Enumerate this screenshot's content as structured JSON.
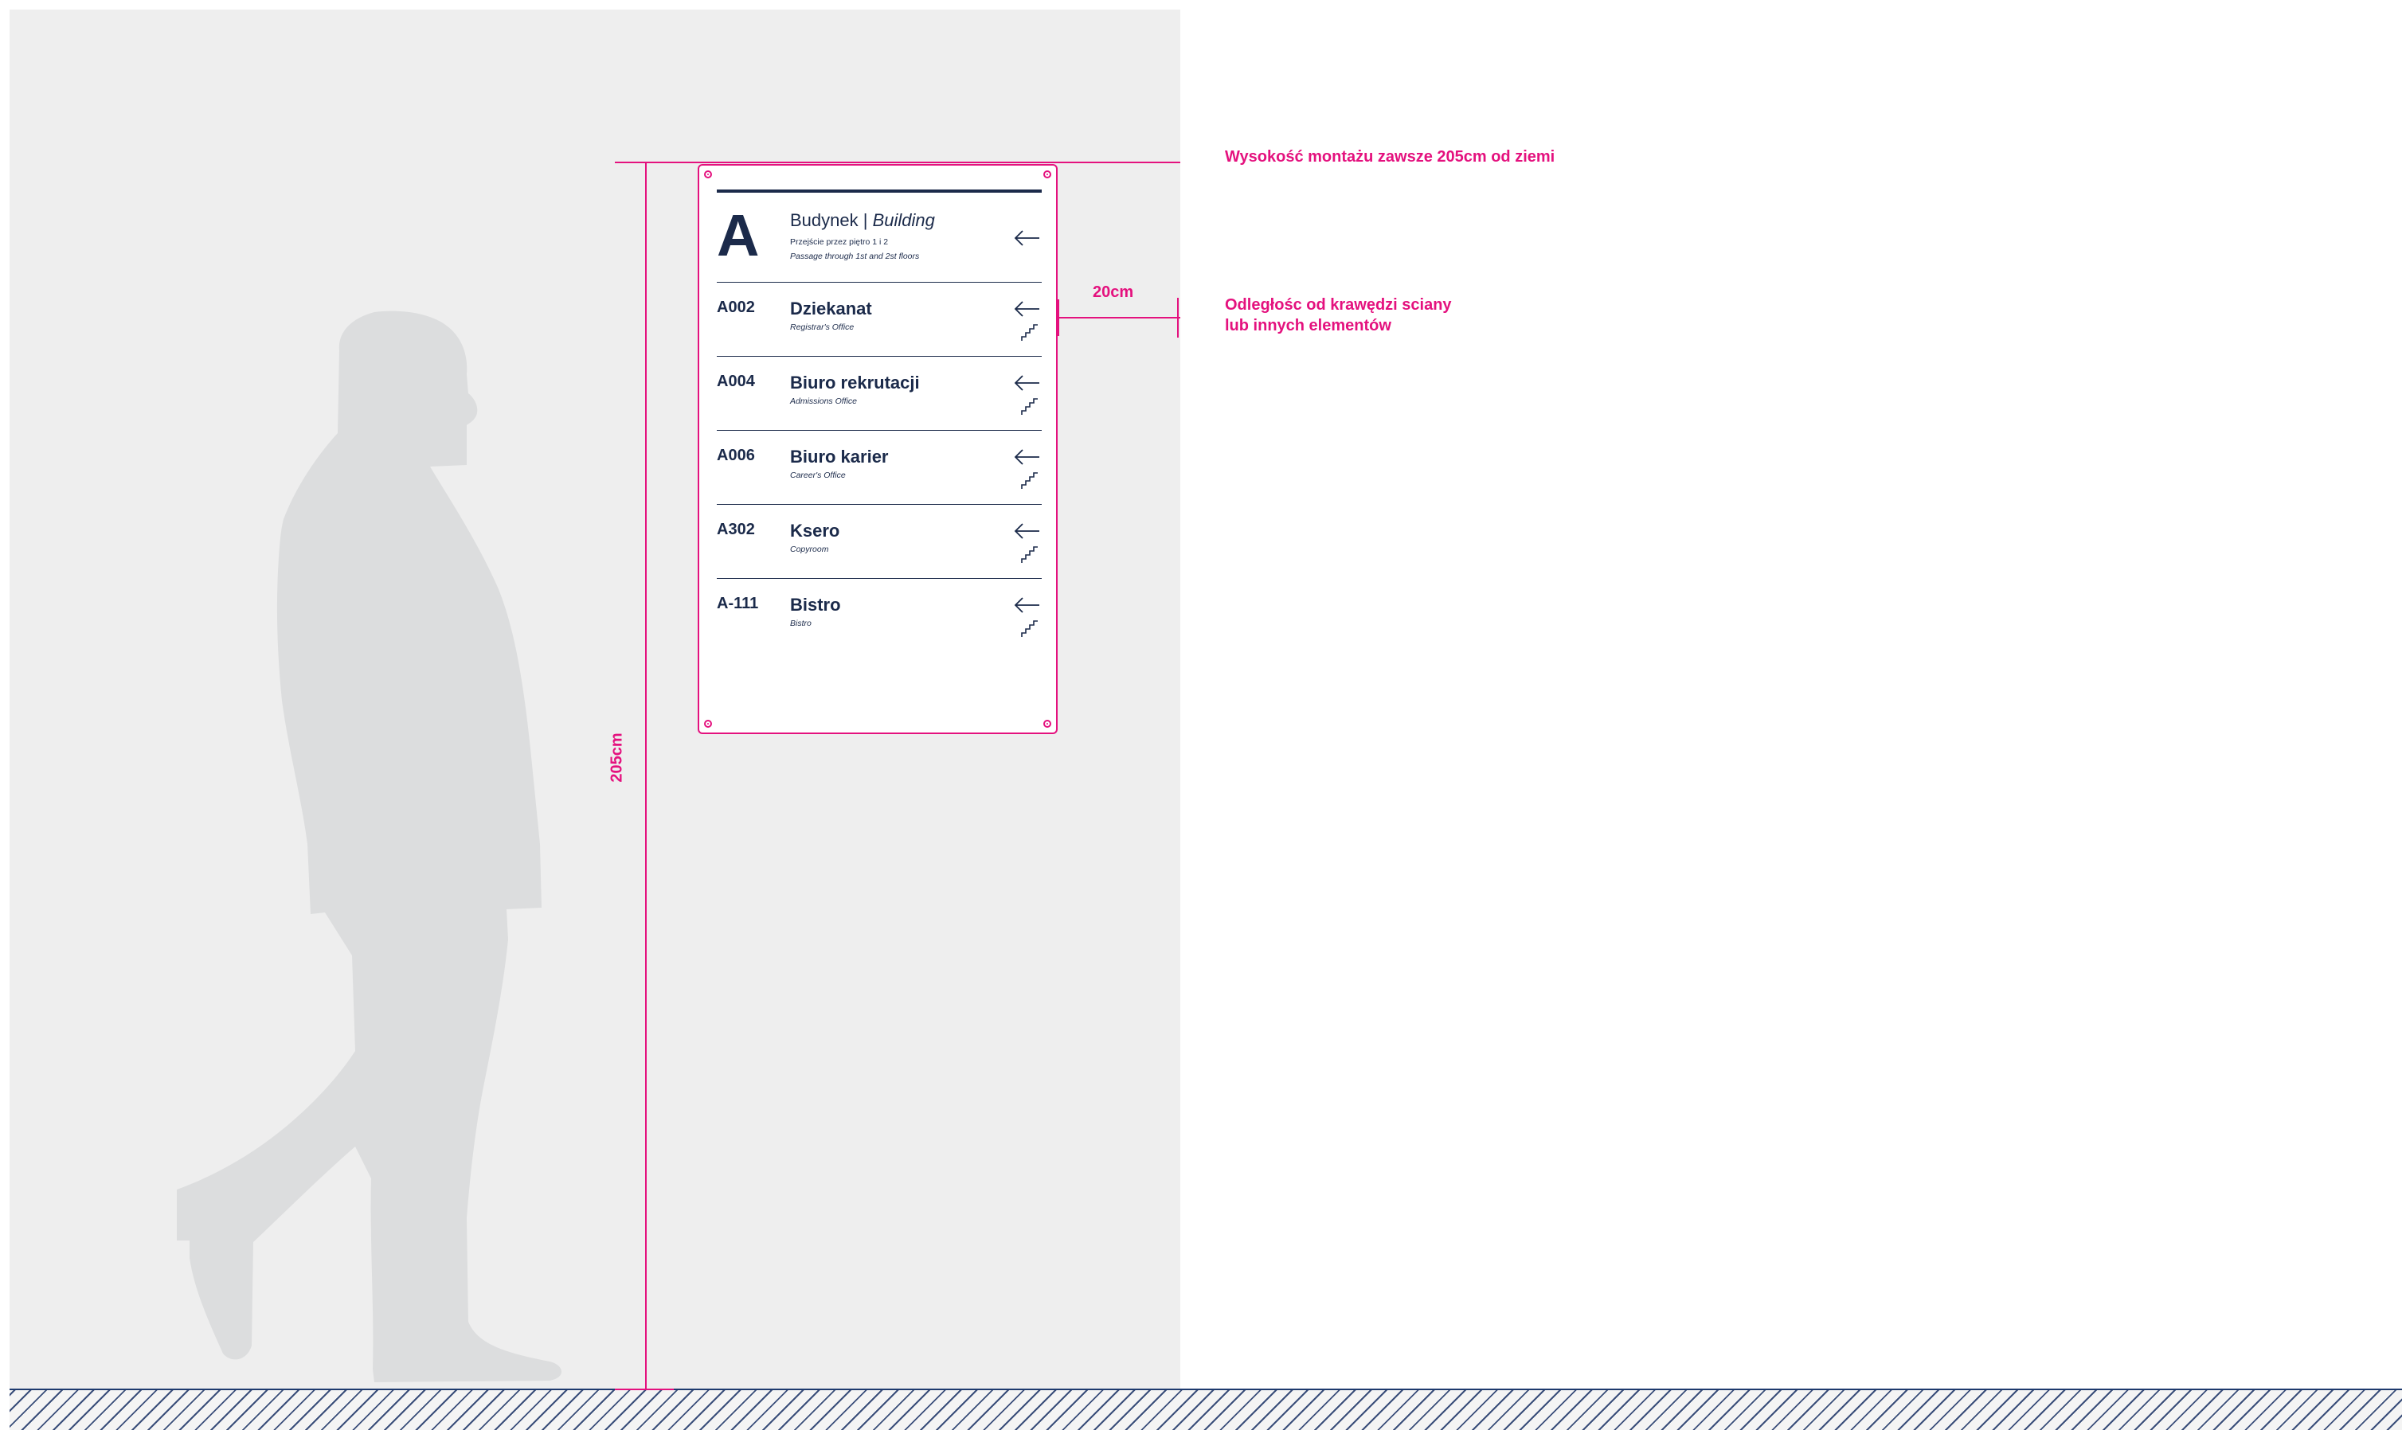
{
  "annotations": {
    "mount_height_note": "Wysokość montażu zawsze 205cm od ziemi",
    "wall_distance_note_line1": "Odległośc od krawędzi sciany",
    "wall_distance_note_line2": "lub innych elementów",
    "horizontal_dimension": "20cm",
    "vertical_dimension": "205cm",
    "accent_color": "#e4117e"
  },
  "sign": {
    "header": {
      "letter": "A",
      "title_regular": "Budynek | ",
      "title_italic": "Building",
      "subtitle_pl": "Przejście przez piętro 1 i 2",
      "subtitle_en": "Passage through 1st and 2st floors",
      "icon": "arrow-left-icon"
    },
    "rows": [
      {
        "number": "A002",
        "name": "Dziekanat",
        "subtitle": "Registrar's Office",
        "icons": [
          "arrow-left-icon",
          "stairs-icon"
        ]
      },
      {
        "number": "A004",
        "name": "Biuro rekrutacji",
        "subtitle": "Admissions Office",
        "icons": [
          "arrow-left-icon",
          "stairs-icon"
        ]
      },
      {
        "number": "A006",
        "name": "Biuro karier",
        "subtitle": "Career's Office",
        "icons": [
          "arrow-left-icon",
          "stairs-icon"
        ]
      },
      {
        "number": "A302",
        "name": "Ksero",
        "subtitle": "Copyroom",
        "icons": [
          "arrow-left-icon",
          "stairs-icon"
        ]
      },
      {
        "number": "A-111",
        "name": "Bistro",
        "subtitle": "Bistro",
        "icons": [
          "arrow-left-icon",
          "stairs-icon"
        ]
      }
    ],
    "text_color": "#1b2a4a"
  }
}
